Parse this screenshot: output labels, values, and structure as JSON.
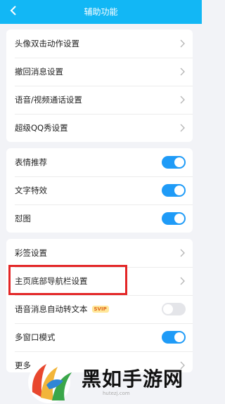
{
  "header": {
    "title": "辅助功能",
    "back_icon": "chevron-left-icon",
    "background": "#12b7f5"
  },
  "group1": [
    {
      "label": "头像双击动作设置"
    },
    {
      "label": "撤回消息设置"
    },
    {
      "label": "语音/视频通话设置"
    },
    {
      "label": "超级QQ秀设置"
    }
  ],
  "group2": [
    {
      "label": "表情推荐",
      "on": true
    },
    {
      "label": "文字特效",
      "on": true
    },
    {
      "label": "怼图",
      "on": true
    }
  ],
  "group3": [
    {
      "label": "彩签设置",
      "control": "chevron"
    },
    {
      "label": "主页底部导航栏设置",
      "control": "chevron",
      "highlighted": true
    },
    {
      "label": "语音消息自动转文本",
      "badge": "SVIP",
      "control": "toggle",
      "on": false
    },
    {
      "label": "多窗口模式",
      "control": "toggle",
      "on": true
    },
    {
      "label": "更多",
      "control": "chevron"
    }
  ],
  "colors": {
    "toggle_on": "#1f9bf7",
    "toggle_off": "#e4e5e9",
    "highlight": "#e32526"
  },
  "watermark": {
    "text": "黑如手游网",
    "url": "hutezj.com"
  }
}
